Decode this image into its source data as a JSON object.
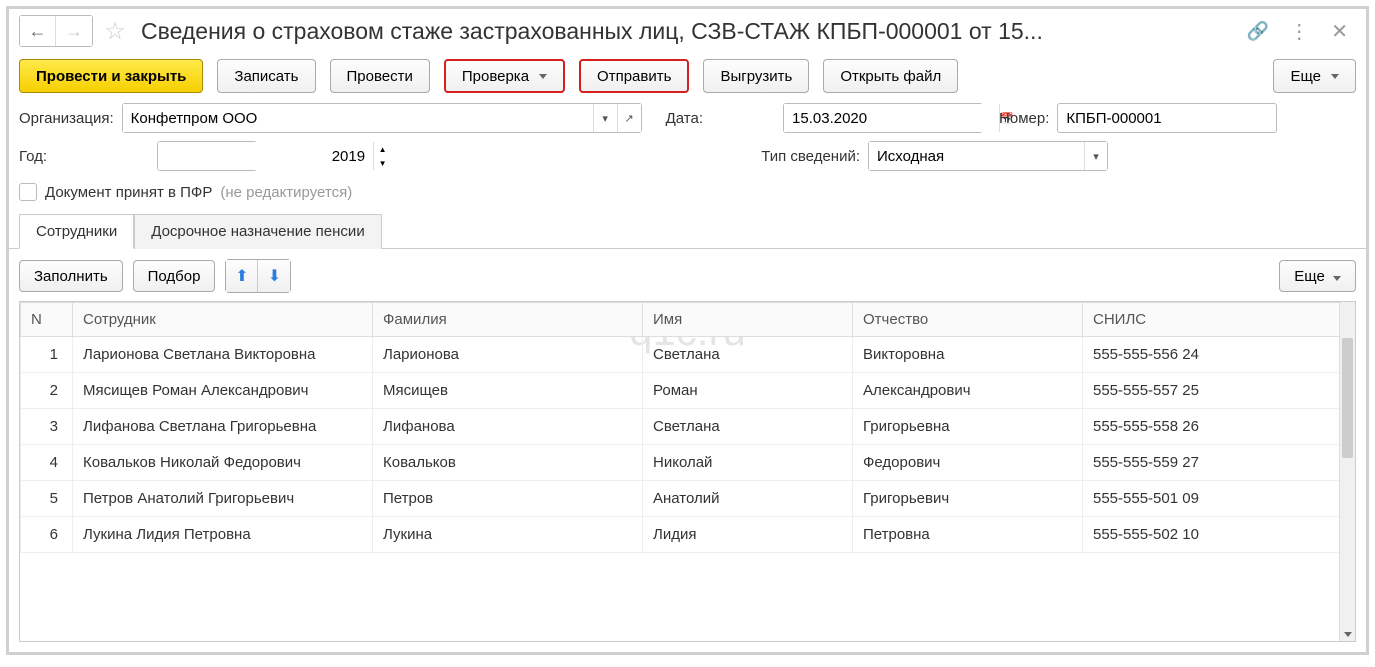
{
  "title": "Сведения о страховом стаже застрахованных лиц, СЗВ-СТАЖ КПБП-000001 от 15...",
  "toolbar": {
    "post_close": "Провести и закрыть",
    "save": "Записать",
    "post": "Провести",
    "check": "Проверка",
    "send": "Отправить",
    "export": "Выгрузить",
    "openfile": "Открыть файл",
    "more": "Еще"
  },
  "form": {
    "org_label": "Организация:",
    "org_value": "Конфетпром ООО",
    "date_label": "Дата:",
    "date_value": "15.03.2020",
    "number_label": "Номер:",
    "number_value": "КПБП-000001",
    "year_label": "Год:",
    "year_value": "2019",
    "info_type_label": "Тип сведений:",
    "info_type_value": "Исходная",
    "pfr_label": "Документ принят в ПФР",
    "pfr_suffix": "(не редактируется)"
  },
  "tabs": {
    "employees": "Сотрудники",
    "pension": "Досрочное назначение пенсии"
  },
  "subtoolbar": {
    "fill": "Заполнить",
    "pick": "Подбор",
    "more": "Еще"
  },
  "columns": {
    "n": "N",
    "employee": "Сотрудник",
    "surname": "Фамилия",
    "name": "Имя",
    "patronymic": "Отчество",
    "snils": "СНИЛС"
  },
  "rows": [
    {
      "n": "1",
      "employee": "Ларионова Светлана Викторовна",
      "surname": "Ларионова",
      "name": "Светлана",
      "patronymic": "Викторовна",
      "snils": "555-555-556 24"
    },
    {
      "n": "2",
      "employee": "Мясищев Роман Александрович",
      "surname": "Мясищев",
      "name": "Роман",
      "patronymic": "Александрович",
      "snils": "555-555-557 25"
    },
    {
      "n": "3",
      "employee": "Лифанова Светлана Григорьевна",
      "surname": "Лифанова",
      "name": "Светлана",
      "patronymic": "Григорьевна",
      "snils": "555-555-558 26"
    },
    {
      "n": "4",
      "employee": "Ковальков Николай Федорович",
      "surname": "Ковальков",
      "name": "Николай",
      "patronymic": "Федорович",
      "snils": "555-555-559 27"
    },
    {
      "n": "5",
      "employee": "Петров Анатолий Григорьевич",
      "surname": "Петров",
      "name": "Анатолий",
      "patronymic": "Григорьевич",
      "snils": "555-555-501 09"
    },
    {
      "n": "6",
      "employee": "Лукина Лидия Петровна",
      "surname": "Лукина",
      "name": "Лидия",
      "patronymic": "Петровна",
      "snils": "555-555-502 10"
    }
  ],
  "watermark": "q1c.ru"
}
